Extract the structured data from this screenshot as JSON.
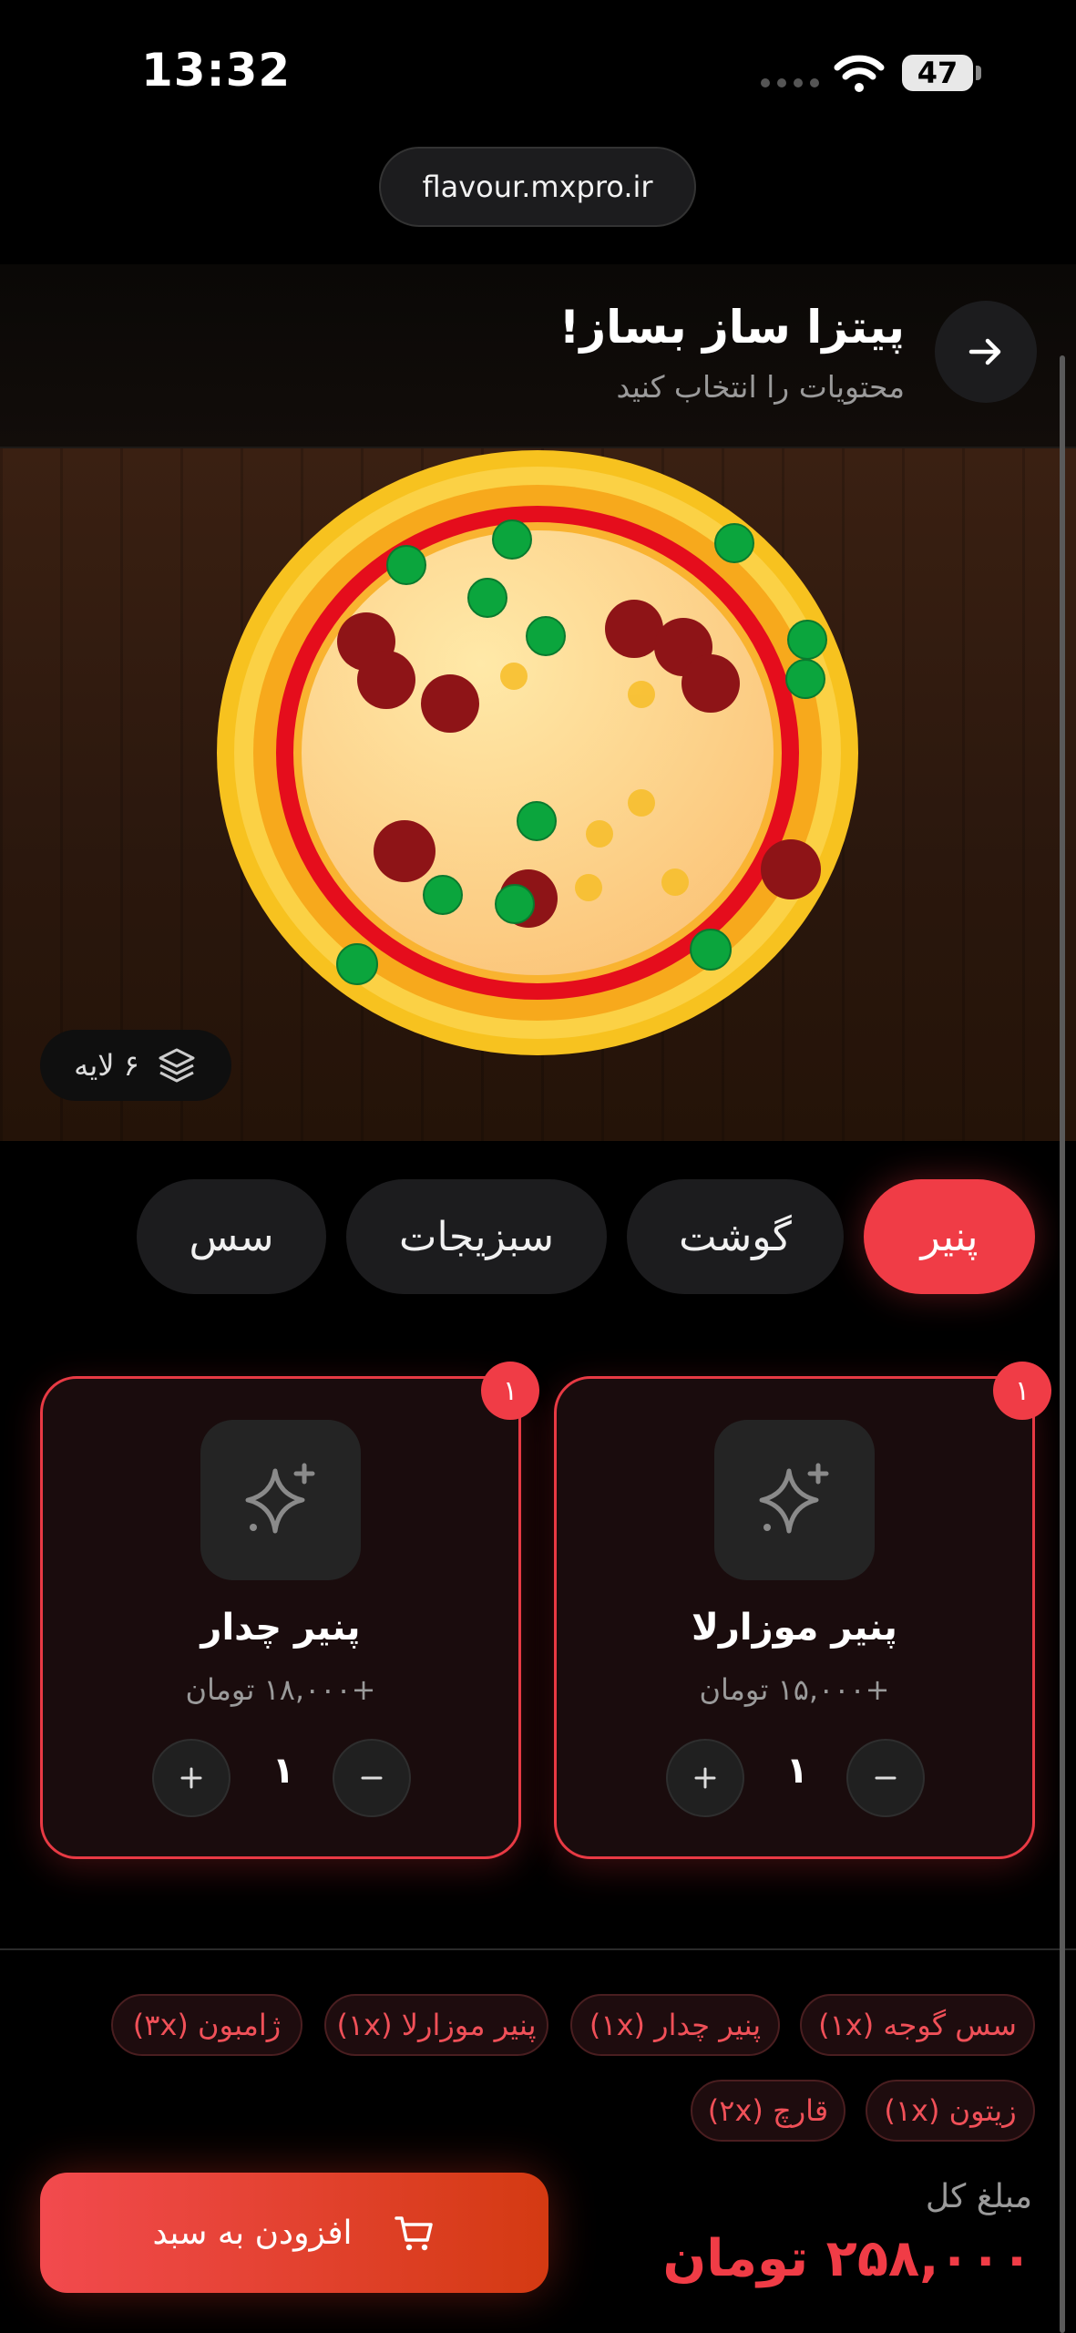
{
  "status_bar": {
    "time": "13:32",
    "battery": "47"
  },
  "browser": {
    "url": "flavour.mxpro.ir"
  },
  "header": {
    "title": "پیتزا ساز بساز!",
    "subtitle": "محتویات را انتخاب کنید"
  },
  "pizza": {
    "layers_label": "۶ لایه"
  },
  "categories": [
    {
      "label": "پنیر",
      "active": true
    },
    {
      "label": "گوشت",
      "active": false
    },
    {
      "label": "سبزیجات",
      "active": false
    },
    {
      "label": "سس",
      "active": false
    }
  ],
  "items": [
    {
      "name": "پنیر موزارلا",
      "price": "+۱۵,۰۰۰ تومان",
      "quantity": "۱",
      "badge": "۱",
      "icon": "sparkles-icon"
    },
    {
      "name": "پنیر چدار",
      "price": "+۱۸,۰۰۰ تومان",
      "quantity": "۱",
      "badge": "۱",
      "icon": "sparkles-icon"
    }
  ],
  "summary_chips": [
    "سس گوجه (۱x)",
    "پنیر چدار (۱x)",
    "پنیر موزارلا (۱x)",
    "ژامبون (۳x)",
    "زیتون (۱x)",
    "قارچ (۲x)"
  ],
  "total": {
    "label": "مبلغ کل",
    "value": "۲۵۸,۰۰۰ تومان"
  },
  "cart_button": {
    "label": "افزودن به سبد",
    "icon": "cart-icon"
  },
  "colors": {
    "accent": "#f03c46",
    "background": "#000000"
  }
}
